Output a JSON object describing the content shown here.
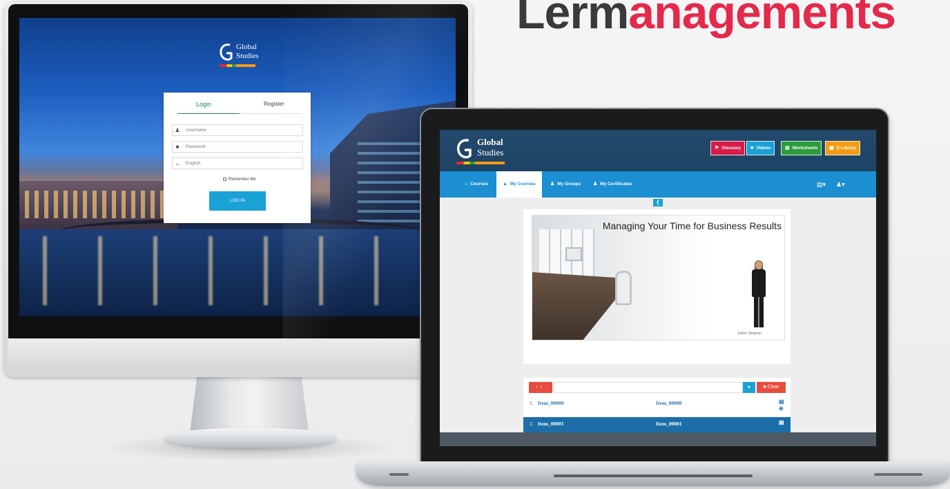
{
  "headline": {
    "part1": "Lerm",
    "part2": "anagements"
  },
  "desktop": {
    "logo": {
      "line1": "Global",
      "line2": "Studies"
    },
    "login": {
      "tab_login": "Login",
      "tab_register": "Register",
      "username_placeholder": "Username",
      "password_placeholder": "Password",
      "language_value": "English",
      "remember_label": "Remember Me",
      "login_button": "LOG IN"
    }
  },
  "laptop": {
    "logo": {
      "line1": "Global",
      "line2": "Studies"
    },
    "header_buttons": [
      {
        "label": "Glossary",
        "icon": "bookmark-icon",
        "color": "#d81b47"
      },
      {
        "label": "Videos",
        "icon": "video-icon",
        "color": "#1aa2d6"
      },
      {
        "label": "Worksheets",
        "icon": "worksheet-icon",
        "color": "#2d9c3c"
      },
      {
        "label": "E-Library",
        "icon": "library-icon",
        "color": "#f39c12"
      }
    ],
    "nav": [
      {
        "label": "Courses",
        "icon": "home-icon"
      },
      {
        "label": "My Courses",
        "icon": "graduation-cap-icon",
        "active": true
      },
      {
        "label": "My Groups",
        "icon": "group-icon"
      },
      {
        "label": "My Certificates",
        "icon": "certificate-icon"
      }
    ],
    "video": {
      "title": "Managing Your Time for Business Results",
      "presenter": "JoAnn Simpson"
    },
    "list": {
      "clear_label": "Clear",
      "rows": [
        {
          "num": "1.",
          "col1": "Item_00000",
          "col2": "Item_00000"
        },
        {
          "num": "2.",
          "col1": "Item_00001",
          "col2": "Item_00001",
          "selected": true
        }
      ]
    }
  },
  "colors": {
    "headline_dark": "#3a3a3a",
    "headline_red": "#e32a4b",
    "nav_blue": "#1b8fd1",
    "header_navy": "#234a6c",
    "login_green": "#138a5b",
    "button_cyan": "#1aa2d6",
    "danger_red": "#e74c3c"
  }
}
